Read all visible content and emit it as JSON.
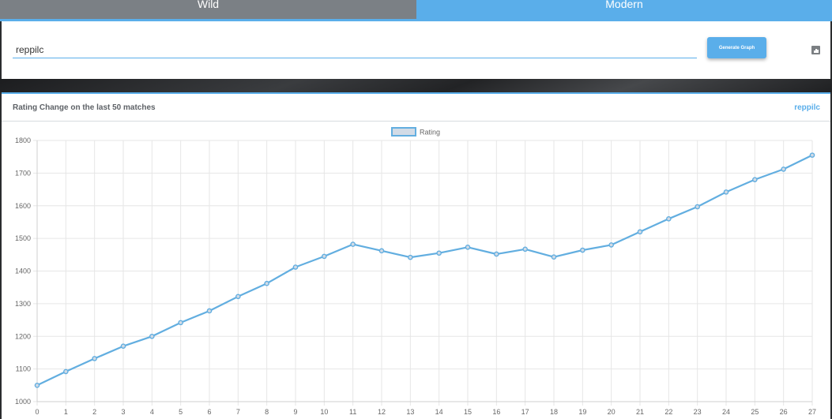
{
  "tabs": [
    {
      "label": "Wild"
    },
    {
      "label": "Modern"
    }
  ],
  "search": {
    "value": "reppilc",
    "button_label": "Generate Graph",
    "chart_icon": "bar-chart-icon"
  },
  "card": {
    "title": "Rating Change on the last 50 matches",
    "user": "reppilc"
  },
  "colors": {
    "accent": "#5aaeea",
    "line": "#62aee0",
    "legend_fill": "#d2dbe6"
  },
  "chart_data": {
    "type": "line",
    "legend": "top-center",
    "grid": true,
    "x": [
      0,
      1,
      2,
      3,
      4,
      5,
      6,
      7,
      8,
      9,
      10,
      11,
      12,
      13,
      14,
      15,
      16,
      17,
      18,
      19,
      20,
      21,
      22,
      23,
      24,
      25,
      26,
      27
    ],
    "series": [
      {
        "name": "Rating",
        "values": [
          1050,
          1092,
          1132,
          1170,
          1200,
          1242,
          1278,
          1322,
          1362,
          1412,
          1445,
          1482,
          1462,
          1442,
          1455,
          1473,
          1452,
          1467,
          1443,
          1464,
          1480,
          1520,
          1560,
          1597,
          1642,
          1680,
          1712,
          1755
        ]
      }
    ],
    "ylim": [
      1000,
      1800
    ],
    "yticks": [
      1000,
      1100,
      1200,
      1300,
      1400,
      1500,
      1600,
      1700,
      1800
    ]
  }
}
